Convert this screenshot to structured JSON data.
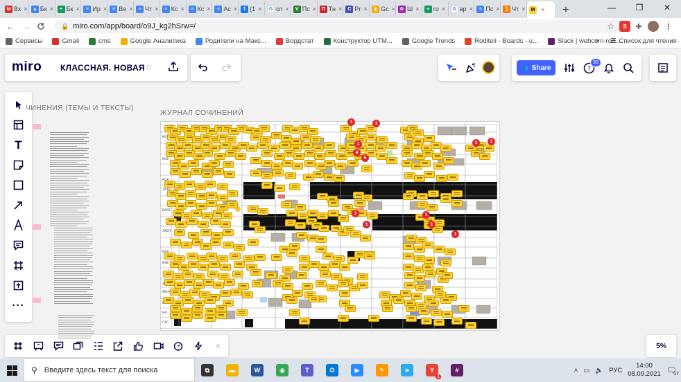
{
  "browser": {
    "tabs": [
      {
        "label": "Вх",
        "icon": "gmail-icon",
        "color": "#d93025",
        "glyph": "M"
      },
      {
        "label": "Бк",
        "icon": "drive-icon",
        "color": "#4285f4",
        "glyph": "▲"
      },
      {
        "label": "Бк",
        "icon": "sheets-icon",
        "color": "#0f9d58",
        "glyph": "+"
      },
      {
        "label": "Ир",
        "icon": "docs-icon",
        "color": "#4285f4",
        "glyph": "≡"
      },
      {
        "label": "Ве",
        "icon": "docs-icon",
        "color": "#4285f4",
        "glyph": "≡"
      },
      {
        "label": "Чт",
        "icon": "docs-icon",
        "color": "#4285f4",
        "glyph": "≡"
      },
      {
        "label": "Кс",
        "icon": "docs-icon",
        "color": "#4285f4",
        "glyph": "≡"
      },
      {
        "label": "Кс",
        "icon": "docs-icon",
        "color": "#4285f4",
        "glyph": "≡"
      },
      {
        "label": "Ас",
        "icon": "docs-icon",
        "color": "#4285f4",
        "glyph": "≡"
      },
      {
        "label": "(1",
        "icon": "facebook-icon",
        "color": "#1877f2",
        "glyph": "f"
      },
      {
        "label": "сп",
        "icon": "google-icon",
        "color": "#ffffff",
        "glyph": "G"
      },
      {
        "label": "Пс",
        "icon": "vk-icon",
        "color": "#2e7d32",
        "glyph": "V"
      },
      {
        "label": "Тн",
        "icon": "planfix-icon",
        "color": "#c62828",
        "glyph": "П"
      },
      {
        "label": "Pr",
        "icon": "circle-app-icon",
        "color": "#3f51b5",
        "glyph": "C"
      },
      {
        "label": "Gc",
        "icon": "analytics-icon",
        "color": "#f9ab00",
        "glyph": "▮"
      },
      {
        "label": "Ш",
        "icon": "colorful-app-icon",
        "color": "#9c27b0",
        "glyph": "✿"
      },
      {
        "label": "го",
        "icon": "sheets-icon",
        "color": "#0f9d58",
        "glyph": "+"
      },
      {
        "label": "ар",
        "icon": "google-icon",
        "color": "#ffffff",
        "glyph": "G"
      },
      {
        "label": "Пс",
        "icon": "docs-icon",
        "color": "#4285f4",
        "glyph": "≡"
      },
      {
        "label": "Чт",
        "icon": "orange-app-icon",
        "color": "#f57c00",
        "glyph": "❯"
      },
      {
        "label": "",
        "icon": "miro-icon",
        "color": "#ffd02f",
        "glyph": "M",
        "active": true
      }
    ],
    "new_tab": "+",
    "window_controls": {
      "minimize": "—",
      "maximize": "❐",
      "close": "✕"
    },
    "nav": {
      "back": "←",
      "forward": "→",
      "reload": "C"
    },
    "url": "miro.com/app/board/o9J_kg2hSrw=/",
    "bookmarks": [
      {
        "label": "Сервисы",
        "icon": "apps-grid-icon",
        "color": "#5f6368"
      },
      {
        "label": "Gmail",
        "icon": "gmail-icon",
        "color": "#d93025"
      },
      {
        "label": "cms",
        "icon": "vk-icon",
        "color": "#2e7d32"
      },
      {
        "label": "Google Аналитика",
        "icon": "analytics-icon",
        "color": "#f9ab00"
      },
      {
        "label": "Родители на Макс...",
        "icon": "docs-icon",
        "color": "#4285f4"
      },
      {
        "label": "Вордстат",
        "icon": "bars-icon",
        "color": "#e53935"
      },
      {
        "label": "Конструктор UTM...",
        "icon": "excel-icon",
        "color": "#1d6f42"
      },
      {
        "label": "Google Trends",
        "icon": "trends-icon",
        "color": "#5f6368"
      },
      {
        "label": "Roditeli - Boards - u...",
        "icon": "gitlab-icon",
        "color": "#e24329"
      },
      {
        "label": "Slack | webcom-rod...",
        "icon": "slack-icon",
        "color": "#611f69"
      }
    ],
    "bookmarks_more": "»",
    "reading_list": "Список для чтения"
  },
  "miro": {
    "logo": "miro",
    "board_title": "КЛАССНАЯ. НОВАЯ",
    "share_label": "Share",
    "collaborators_count": "30",
    "zoom": "5%",
    "frames": [
      {
        "label": "ЧИНЕНИЯ (ТЕМЫ И ТЕКСТЫ)"
      },
      {
        "label": "ЖУРНАЛ СОЧИНЕНИЙ"
      }
    ],
    "grid_row_labels": [
      "КО",
      "КСЕ",
      "КСК",
      "1АТА",
      "ВАСЕ",
      "ЗАЕЛ",
      "ВАЛ",
      "ВЭБ",
      "ДАН",
      "МОЛ",
      "ЕЛИ",
      "КА",
      "ГАС"
    ],
    "notification_counts": [
      "1",
      "1",
      "1",
      "4",
      "5",
      "1",
      "1",
      "1",
      "1",
      "1",
      "1",
      "1"
    ]
  },
  "taskbar": {
    "search_placeholder": "Введите здесь текст для поиска",
    "apps": [
      {
        "icon": "task-view-icon",
        "color": "#333333",
        "glyph": "⧉"
      },
      {
        "icon": "explorer-icon",
        "color": "#f2b200",
        "glyph": "▬"
      },
      {
        "icon": "word-icon",
        "color": "#2b579a",
        "glyph": "W"
      },
      {
        "icon": "chrome-icon",
        "color": "#34a853",
        "glyph": "◉"
      },
      {
        "icon": "teams-icon",
        "color": "#5b5fc7",
        "glyph": "T"
      },
      {
        "icon": "outlook-icon",
        "color": "#0078d4",
        "glyph": "O"
      },
      {
        "icon": "zoom-icon",
        "color": "#2d8cff",
        "glyph": "▶"
      },
      {
        "icon": "miro-app-icon",
        "color": "#ff9800",
        "glyph": "✎"
      },
      {
        "icon": "telegram-icon",
        "color": "#2aabee",
        "glyph": "➤"
      },
      {
        "icon": "yandex-icon",
        "color": "#ea4335",
        "glyph": "Y"
      },
      {
        "icon": "slack-icon",
        "color": "#611f69",
        "glyph": "#"
      }
    ],
    "yandex_badge": "1",
    "lang": "РУС",
    "time": "14:00",
    "date": "08.09.2021",
    "notifications": "17"
  }
}
